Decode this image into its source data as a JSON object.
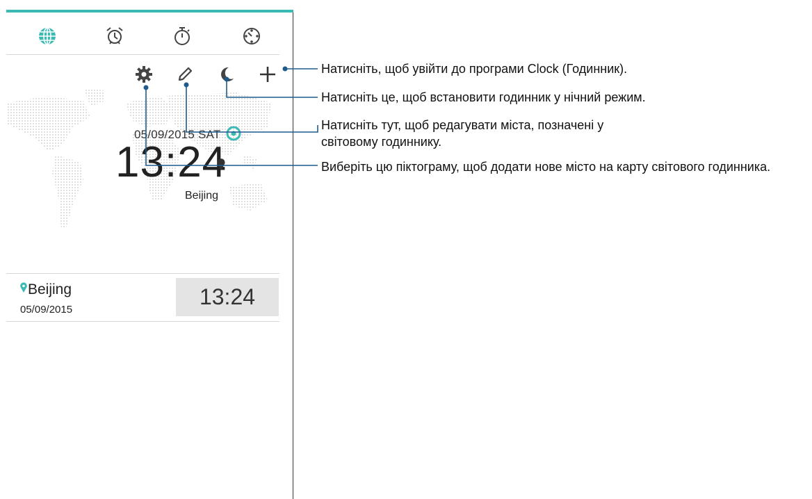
{
  "tabs": [
    {
      "icon": "globe-icon",
      "active": true
    },
    {
      "icon": "alarm-icon",
      "active": false
    },
    {
      "icon": "stopwatch-icon",
      "active": false
    },
    {
      "icon": "timer-icon",
      "active": false
    }
  ],
  "toolbar": {
    "icons": [
      "settings-gear-icon",
      "edit-pencil-icon",
      "night-mode-moon-icon",
      "add-plus-icon"
    ]
  },
  "world_clock": {
    "date": "05/09/2015 SAT",
    "time": "13:24",
    "city": "Beijing"
  },
  "city_list": [
    {
      "city": "Beijing",
      "date": "05/09/2015",
      "time": "13:24"
    }
  ],
  "callouts": [
    "Натисніть, щоб увійти до програми Clock (Годинник).",
    "Натисніть це, щоб встановити годинник у нічний режим.",
    "Натисніть тут, щоб редагувати міста, позначені у світовому годиннику.",
    "Виберіть цю піктограму, щоб додати нове місто на карту світового годинника."
  ],
  "colors": {
    "accent": "#3bbab2",
    "line": "#1f5a8c"
  }
}
